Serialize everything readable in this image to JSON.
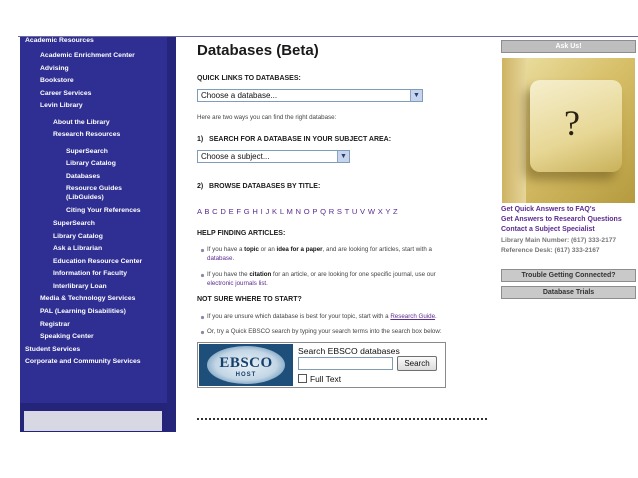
{
  "sidebar": {
    "items": [
      {
        "label": "Academic Resources"
      },
      {
        "label": "Academic Enrichment Center"
      },
      {
        "label": "Advising"
      },
      {
        "label": "Bookstore"
      },
      {
        "label": "Career Services"
      },
      {
        "label": "Levin Library"
      },
      {
        "label": "About the Library"
      },
      {
        "label": "Research Resources"
      },
      {
        "label": "SuperSearch"
      },
      {
        "label": "Library Catalog"
      },
      {
        "label": "Databases"
      },
      {
        "label": "Resource Guides"
      },
      {
        "label": "(LibGuides)"
      },
      {
        "label": "Citing Your References"
      },
      {
        "label": "SuperSearch"
      },
      {
        "label": "Library Catalog"
      },
      {
        "label": "Ask a Librarian"
      },
      {
        "label": "Education Resource Center"
      },
      {
        "label": "Information for Faculty"
      },
      {
        "label": "Interlibrary Loan"
      },
      {
        "label": "Media & Technology Services"
      },
      {
        "label": "PAL (Learning Disabilities)"
      },
      {
        "label": "Registrar"
      },
      {
        "label": "Speaking Center"
      },
      {
        "label": "Student Services"
      },
      {
        "label": "Corporate and Community Services"
      }
    ]
  },
  "main": {
    "title": "Databases (Beta)",
    "quick_links_label": "QUICK LINKS TO DATABASES:",
    "quick_links_select": "Choose a database...",
    "intro": "Here are two ways you can find the right database:",
    "search_subject_label": "1)   SEARCH FOR A DATABASE IN YOUR SUBJECT AREA:",
    "subject_select": "Choose a subject...",
    "browse_label": "2)   BROWSE DATABASES BY TITLE:",
    "alphabet": [
      "A",
      "B",
      "C",
      "D",
      "E",
      "F",
      "G",
      "H",
      "I",
      "J",
      "K",
      "L",
      "M",
      "N",
      "O",
      "P",
      "Q",
      "R",
      "S",
      "T",
      "U",
      "V",
      "W",
      "X",
      "Y",
      "Z"
    ],
    "help_label": "HELP FINDING ARTICLES:",
    "help1": {
      "pre": "If you have a ",
      "bold1": "topic",
      "mid1": " or an ",
      "bold2": "idea for a paper",
      "post": ", and are looking for articles, start with a",
      "link": "database",
      "end": "."
    },
    "help2": {
      "pre": "If you have the ",
      "bold": "citation",
      "post": " for an article, or are looking for one specific journal, use our",
      "link": "electronic journals list",
      "end": "."
    },
    "not_sure_label": "NOT SURE WHERE TO START?",
    "not_sure1": {
      "pre": "If you are unsure which database is best for your topic, start with a ",
      "link": "Research Guide",
      "end": "."
    },
    "not_sure2": "Or, try a Quick EBSCO search by typing your search terms into the search box below:",
    "ebsco": {
      "logo_text": "EBSCO",
      "logo_sub": "HOST",
      "title": "Search EBSCO databases",
      "button": "Search",
      "checkbox_label": "Full Text"
    }
  },
  "right": {
    "ask_us": "Ask Us!",
    "links": [
      "Get Quick Answers to FAQ's",
      "Get Answers to Research Questions",
      "Contact a Subject Specialist"
    ],
    "phone_main": "Library Main Number: (617) 333-2177",
    "phone_ref": "Reference Desk: (617) 333-2167",
    "trouble_button": "Trouble Getting Connected?",
    "trials_button": "Database Trials"
  },
  "colors": {
    "sidebar": "#2f2f93",
    "link": "#5b2b8f",
    "button_gray": "#bebebe"
  }
}
